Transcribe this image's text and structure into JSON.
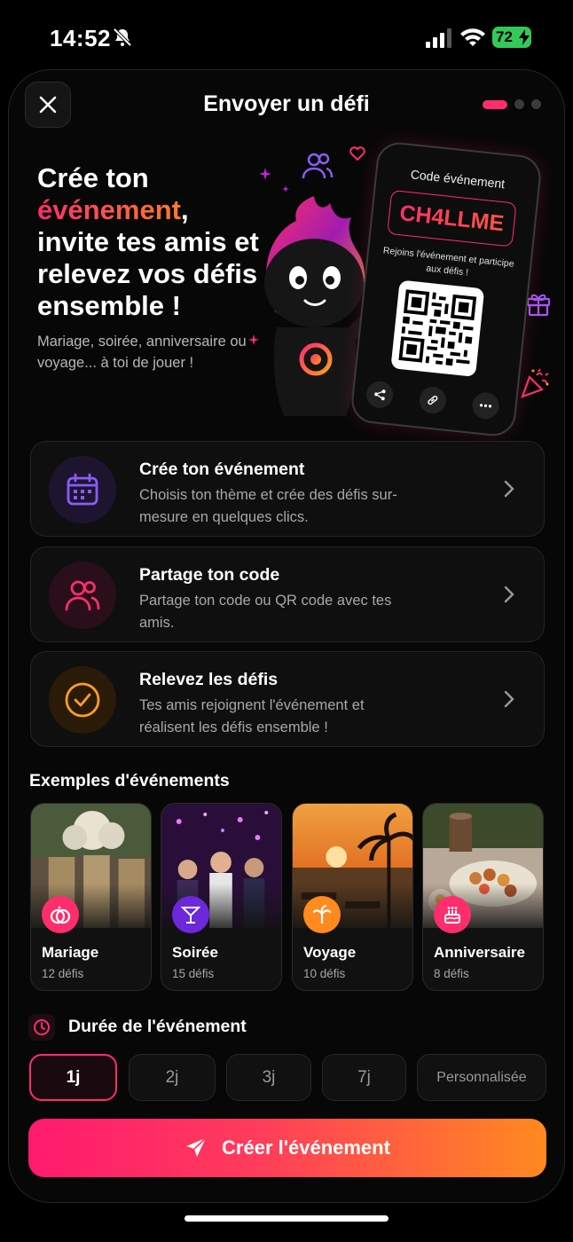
{
  "status": {
    "time": "14:52",
    "battery": "72"
  },
  "header": {
    "title": "Envoyer un défi"
  },
  "hero": {
    "title_line1": "Crée ton",
    "title_accent": "événement",
    "title_comma": ",",
    "title_rest": "invite tes amis et relevez vos défis ensemble !",
    "subtitle": "Mariage, soirée, anniversaire ou voyage... à toi de jouer !",
    "phone_label": "Code événement",
    "phone_code": "CH4LLME",
    "phone_invite": "Rejoins l'événement et participe aux défis !"
  },
  "steps": [
    {
      "title": "Crée ton événement",
      "desc": "Choisis ton thème et crée des défis sur-mesure en quelques clics.",
      "icon": "calendar-icon",
      "color": "#8b5cf6"
    },
    {
      "title": "Partage ton code",
      "desc": "Partage ton code ou QR code avec tes amis.",
      "icon": "users-icon",
      "color": "#ff2d6b"
    },
    {
      "title": "Relevez les défis",
      "desc": "Tes amis rejoignent l'événement et réalisent les défis ensemble !",
      "icon": "check-circle-icon",
      "color": "#ff9f1c"
    }
  ],
  "examples": {
    "label": "Exemples d'événements",
    "items": [
      {
        "name": "Mariage",
        "count": "12 défis",
        "icon": "rings-icon",
        "color": "#ff2d6b"
      },
      {
        "name": "Soirée",
        "count": "15 défis",
        "icon": "cocktail-icon",
        "color": "#7c3aed"
      },
      {
        "name": "Voyage",
        "count": "10 défis",
        "icon": "palm-tree-icon",
        "color": "#ff8a1f"
      },
      {
        "name": "Anniversaire",
        "count": "8 défis",
        "icon": "cake-icon",
        "color": "#ff2d6b"
      }
    ]
  },
  "duration": {
    "label": "Durée de l'événement",
    "options": [
      "1j",
      "2j",
      "3j",
      "7j",
      "Personnalisée"
    ],
    "selected": "1j"
  },
  "cta": {
    "label": "Créer l'événement"
  }
}
